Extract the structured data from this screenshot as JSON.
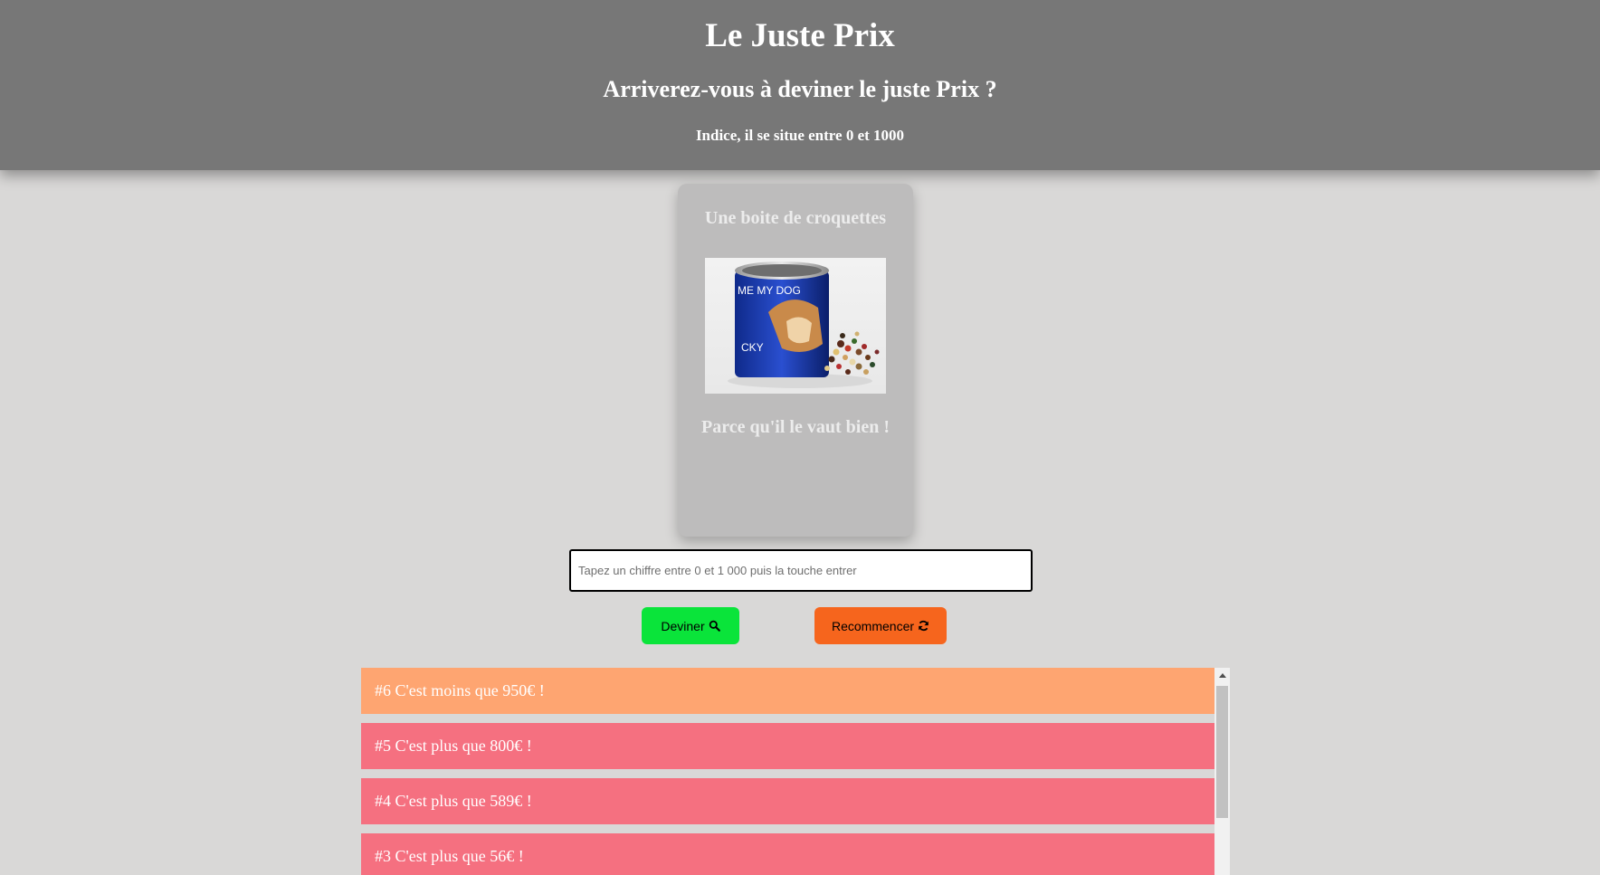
{
  "header": {
    "title": "Le Juste Prix",
    "subtitle": "Arriverez-vous à deviner le juste Prix ?",
    "hint": "Indice, il se situe entre 0 et 1000"
  },
  "card": {
    "title": "Une boite de croquettes",
    "image_label": "ME MY DOG",
    "image_label2": "CKY",
    "tagline": "Parce qu'il le vaut bien !"
  },
  "input": {
    "value": "",
    "placeholder": "Tapez un chiffre entre 0 et 1 000 puis la touche entrer"
  },
  "buttons": {
    "guess_label": "Deviner",
    "guess_icon": "search-icon",
    "restart_label": "Recommencer",
    "restart_icon": "refresh-icon"
  },
  "history": [
    {
      "text": "#6 C'est moins que 950€ !",
      "color": "#fea571"
    },
    {
      "text": "#5 C'est plus que 800€ !",
      "color": "#f57080"
    },
    {
      "text": "#4 C'est plus que 589€ !",
      "color": "#f57080"
    },
    {
      "text": "#3 C'est plus que 56€ !",
      "color": "#f57080"
    }
  ],
  "colors": {
    "header_bg": "#777777",
    "page_bg": "#d9d8d7",
    "card_bg": "#bdbcbc",
    "guess_button": "#0ae43a",
    "restart_button": "#f6651d",
    "less_than": "#fea571",
    "more_than": "#f57080"
  }
}
